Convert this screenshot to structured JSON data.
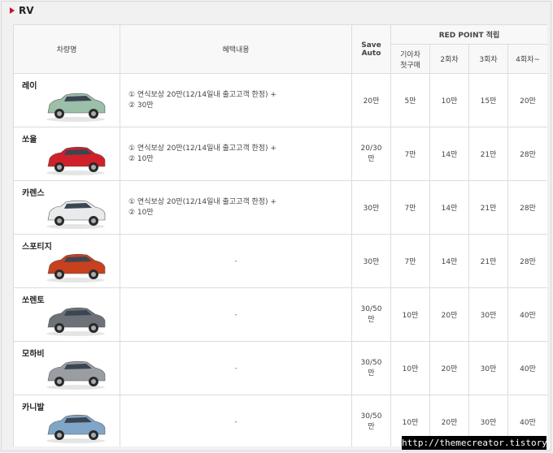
{
  "section": {
    "title": "RV"
  },
  "headers": {
    "car_name": "차량명",
    "benefit": "혜택내용",
    "save_auto_line1": "Save",
    "save_auto_line2": "Auto",
    "red_point": "RED POINT 적립",
    "first_buy_line1": "기아차",
    "first_buy_line2": "첫구매",
    "second": "2회차",
    "third": "3회차",
    "fourth": "4회차~"
  },
  "rows": [
    {
      "name": "레이",
      "benefit_line1": "① 연식보상 20만(12/14일내 출고고객 한정) +",
      "benefit_line2": "② 30만",
      "save_auto_line1": "20만",
      "save_auto_line2": "",
      "first": "5만",
      "second": "10만",
      "third": "15만",
      "fourth": "20만",
      "color": "#9bbfa8"
    },
    {
      "name": "쏘울",
      "benefit_line1": "① 연식보상 20만(12/14일내 출고고객 한정) +",
      "benefit_line2": "② 10만",
      "save_auto_line1": "20/30",
      "save_auto_line2": "만",
      "first": "7만",
      "second": "14만",
      "third": "21만",
      "fourth": "28만",
      "color": "#d0202a"
    },
    {
      "name": "카렌스",
      "benefit_line1": "① 연식보상 20만(12/14일내 출고고객 한정) +",
      "benefit_line2": "② 10만",
      "save_auto_line1": "30만",
      "save_auto_line2": "",
      "first": "7만",
      "second": "14만",
      "third": "21만",
      "fourth": "28만",
      "color": "#e8eaec"
    },
    {
      "name": "스포티지",
      "benefit_line1": "-",
      "benefit_line2": "",
      "save_auto_line1": "30만",
      "save_auto_line2": "",
      "first": "7만",
      "second": "14만",
      "third": "21만",
      "fourth": "28만",
      "color": "#c8401e"
    },
    {
      "name": "쏘렌토",
      "benefit_line1": "-",
      "benefit_line2": "",
      "save_auto_line1": "30/50",
      "save_auto_line2": "만",
      "first": "10만",
      "second": "20만",
      "third": "30만",
      "fourth": "40만",
      "color": "#6d7178"
    },
    {
      "name": "모하비",
      "benefit_line1": "-",
      "benefit_line2": "",
      "save_auto_line1": "30/50",
      "save_auto_line2": "만",
      "first": "10만",
      "second": "20만",
      "third": "30만",
      "fourth": "40만",
      "color": "#9a9ea3"
    },
    {
      "name": "카니발",
      "benefit_line1": "-",
      "benefit_line2": "",
      "save_auto_line1": "30/50",
      "save_auto_line2": "만",
      "first": "10만",
      "second": "20만",
      "third": "30만",
      "fourth": "40만",
      "color": "#7fa6c8"
    }
  ],
  "watermark": "http://themecreator.tistory.com"
}
